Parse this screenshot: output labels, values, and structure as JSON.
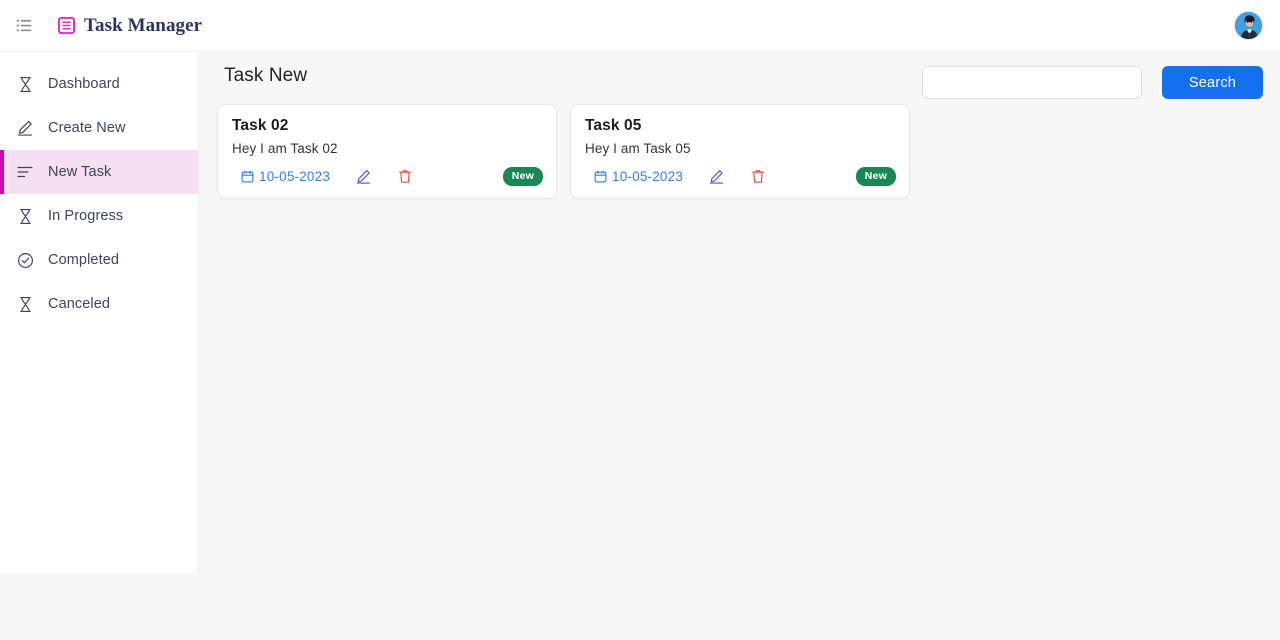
{
  "header": {
    "menu_icon": "hamburger-list-icon",
    "logo_icon": "list-box-icon",
    "title": "Task Manager",
    "avatar_icon": "user-avatar"
  },
  "sidebar": {
    "items": [
      {
        "label": "Dashboard",
        "icon": "hourglass-icon",
        "active": false
      },
      {
        "label": "Create New",
        "icon": "pencil-icon",
        "active": false
      },
      {
        "label": "New Task",
        "icon": "align-left-icon",
        "active": true
      },
      {
        "label": "In Progress",
        "icon": "hourglass-icon",
        "active": false
      },
      {
        "label": "Completed",
        "icon": "check-circle-icon",
        "active": false
      },
      {
        "label": "Canceled",
        "icon": "hourglass-icon",
        "active": false
      }
    ]
  },
  "main": {
    "page_title": "Task New",
    "search": {
      "value": "",
      "placeholder": "",
      "button_label": "Search"
    },
    "cards": [
      {
        "title": "Task 02",
        "description": "Hey I am Task 02",
        "date": "10-05-2023",
        "date_icon": "calendar-icon",
        "edit_icon": "pencil-edit-icon",
        "delete_icon": "trash-icon",
        "badge": "New"
      },
      {
        "title": "Task 05",
        "description": "Hey I am Task 05",
        "date": "10-05-2023",
        "date_icon": "calendar-icon",
        "edit_icon": "pencil-edit-icon",
        "delete_icon": "trash-icon",
        "badge": "New"
      }
    ]
  },
  "colors": {
    "accent_magenta": "#cf0aab",
    "active_row_bg": "#f5dff0",
    "primary_blue": "#1570f0",
    "date_blue": "#2e7fe8",
    "edit_blue": "#4052d6",
    "delete_red": "#f04438",
    "badge_green": "#1a8754",
    "page_bg": "#f7f7f8",
    "brand_navy": "#2d3463"
  }
}
